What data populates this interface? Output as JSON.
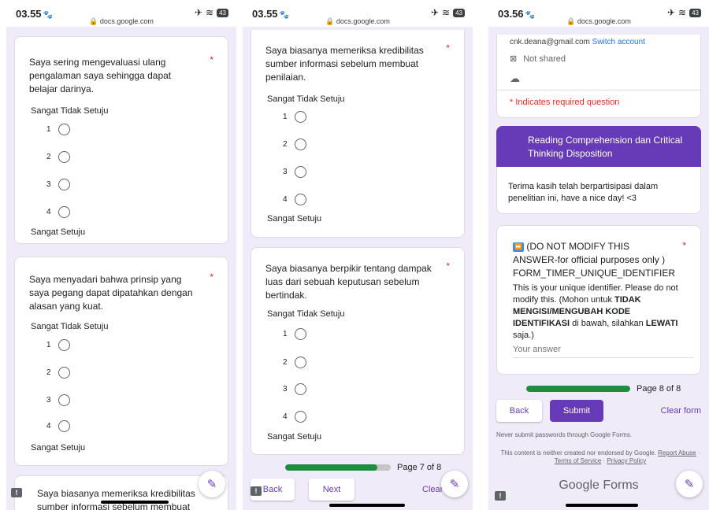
{
  "p1": {
    "time": "03.55",
    "url": "docs.google.com",
    "q1": {
      "text": "Saya sering mengevaluasi ulang pengalaman saya sehingga dapat belajar darinya.",
      "low_label": "Sangat Tidak Setuju",
      "high_label": "Sangat Setuju",
      "options": [
        "1",
        "2",
        "3",
        "4"
      ]
    },
    "q2": {
      "text": "Saya menyadari bahwa prinsip yang saya pegang dapat dipatahkan dengan alasan yang kuat.",
      "low_label": "Sangat Tidak Setuju",
      "high_label": "Sangat Setuju",
      "options": [
        "1",
        "2",
        "3",
        "4"
      ]
    },
    "q3_partial": {
      "line1": "Saya biasanya memeriksa kredibilitas",
      "line2": "sumber informasi sebelum membuat"
    }
  },
  "p2": {
    "time": "03.55",
    "url": "docs.google.com",
    "q1": {
      "text": "Saya biasanya memeriksa kredibilitas sumber informasi sebelum membuat penilaian.",
      "low_label": "Sangat Tidak Setuju",
      "high_label": "Sangat Setuju",
      "options": [
        "1",
        "2",
        "3",
        "4"
      ]
    },
    "q2": {
      "text": "Saya biasanya berpikir tentang dampak luas dari sebuah keputusan sebelum bertindak.",
      "low_label": "Sangat Tidak Setuju",
      "high_label": "Sangat Setuju",
      "options": [
        "1",
        "2",
        "3",
        "4"
      ]
    },
    "progress": {
      "label": "Page 7 of 8",
      "fraction": 0.875
    },
    "buttons": {
      "back": "Back",
      "next": "Next",
      "clear": "Clear form"
    }
  },
  "p3": {
    "time": "03.56",
    "url": "docs.google.com",
    "email": "cnk.deana@gmail.com",
    "switch_account": "Switch account",
    "not_shared": "Not shared",
    "required_note": "* Indicates required question",
    "section_title": "Reading Comprehension dan Critical Thinking Disposition",
    "thanks": "Terima kasih telah berpartisipasi dalam penelitian ini, have a nice day! <3",
    "q": {
      "line1": "(DO NOT MODIFY THIS ANSWER-for official purposes only )",
      "line2": "FORM_TIMER_UNIQUE_IDENTIFIER",
      "desc_a": "This is your unique identifier. Please do not modify this.  (Mohon untuk ",
      "desc_b": "TIDAK MENGISI/MENGUBAH KODE IDENTIFIKASI",
      "desc_c": " di bawah, silahkan ",
      "desc_d": "LEWATI",
      "desc_e": " saja.)",
      "placeholder": "Your answer"
    },
    "progress": {
      "label": "Page 8 of 8",
      "fraction": 1.0
    },
    "buttons": {
      "back": "Back",
      "submit": "Submit",
      "clear": "Clear form"
    },
    "never_submit": "Never submit passwords through Google Forms.",
    "disclaimer": "This content is neither created nor endorsed by Google.",
    "report": "Report Abuse",
    "terms": "Terms of Service",
    "privacy": "Privacy Policy",
    "brand": "Google Forms"
  },
  "colors": {
    "accent": "#673ab7",
    "background": "#f0ebf8",
    "required": "#d93025",
    "progress": "#1e8e3e"
  }
}
